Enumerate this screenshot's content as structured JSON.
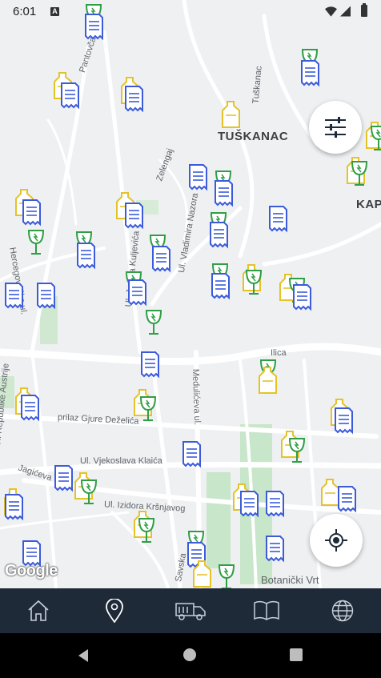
{
  "status_bar": {
    "time": "6:01",
    "notification_icon": "A"
  },
  "map": {
    "district_labels": [
      "TUŠKANAC",
      "KAP"
    ],
    "street_labels": [
      "Pantovčak",
      "Tuškanac",
      "Zelengaj",
      "Ul. Vladimira Nazora",
      "Ul. Josipa Kuljevića",
      "Hercegovačka ul.",
      "Ilica",
      "Medulićeva ul.",
      "Ul. Republike Austrije",
      "prilaz Gjure Deželića",
      "Ul. Vjekoslava Klaića",
      "Jagićeva",
      "Ul. Izidora Kršnjavog",
      "Savska",
      "Botanički Vrt"
    ],
    "attribution": "Google",
    "colors": {
      "blue_marker": "#3b5bdb",
      "green_marker": "#2f9e44",
      "yellow_marker": "#e6c229",
      "park": "#c8e6c9",
      "nav_bg": "#1e2a38"
    },
    "marker_icons": [
      "document-icon",
      "glass-icon",
      "bottle-icon"
    ]
  },
  "controls": {
    "filter_icon": "sliders-icon",
    "locate_icon": "crosshair-icon"
  },
  "bottom_nav": [
    "home-icon",
    "location-pin-icon",
    "garbage-truck-icon",
    "book-icon",
    "globe-icon"
  ],
  "system_nav": [
    "back-icon",
    "home-icon",
    "recents-icon"
  ]
}
